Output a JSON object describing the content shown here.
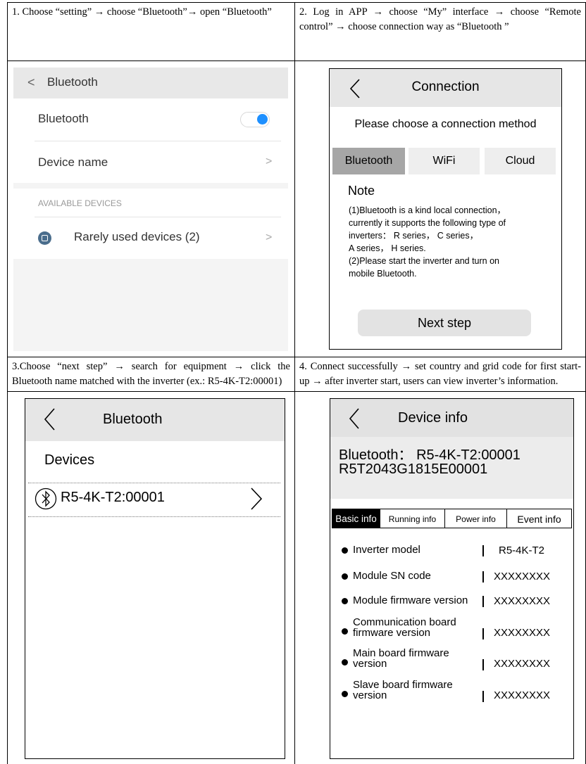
{
  "steps": {
    "step1": "1. Choose “setting” → choose “Bluetooth”→ open “Bluetooth”",
    "step2": "2. Log in APP → choose “My” interface → choose “Remote control” → choose connection way as “Bluetooth ”",
    "step3": "3.Choose “next step” → search for equipment → click the Bluetooth name matched with the inverter (ex.: R5-4K-T2:00001)",
    "step4": "4. Connect successfully → set country and grid code for first start-up → after inverter start, users can view inverter’s information."
  },
  "panel1": {
    "back_symbol": "<",
    "title": "Bluetooth",
    "bluetooth_label": "Bluetooth",
    "bluetooth_toggle_on": true,
    "device_name_label": "Device name",
    "chevron": ">",
    "section_header": "AVAILABLE DEVICES",
    "rare_devices_label": "Rarely used devices (2)",
    "toggle_color": "#1e90ff"
  },
  "panel2": {
    "back_symbol": "<",
    "title": "Connection",
    "prompt": "Please choose a connection method",
    "tabs": [
      "Bluetooth",
      "WiFi",
      "Cloud"
    ],
    "selected_tab": "Bluetooth",
    "note_title": "Note",
    "note_lines": [
      "(1)Bluetooth is a kind local connection，",
      "currently it supports the following type of",
      "inverters： R series， C series，",
      "A series， H series.",
      "(2)Please start the inverter and turn on",
      "mobile Bluetooth."
    ],
    "next_button": "Next step"
  },
  "panel3": {
    "back_symbol": "<",
    "title": "Bluetooth",
    "devices_label": "Devices",
    "device_name": "R5-4K-T2:00001",
    "chevron": ">"
  },
  "panel4": {
    "back_symbol": "<",
    "title": "Device info",
    "bluetooth_line": "Bluetooth： R5-4K-T2:00001",
    "serial_line": "R5T2043G1815E00001",
    "tabs": [
      "Basic info",
      "Running info",
      "Power info",
      "Event info"
    ],
    "selected_tab": "Basic info",
    "items": [
      {
        "label": "Inverter model",
        "value": "R5-4K-T2"
      },
      {
        "label": "Module SN code",
        "value": "XXXXXXXX"
      },
      {
        "label": "Module firmware version",
        "value": "XXXXXXXX"
      },
      {
        "label": "Communication board firmware version",
        "value": "XXXXXXXX"
      },
      {
        "label": "Main board firmware version",
        "value": "XXXXXXXX"
      },
      {
        "label": "Slave board firmware version",
        "value": "XXXXXXXX"
      }
    ]
  }
}
